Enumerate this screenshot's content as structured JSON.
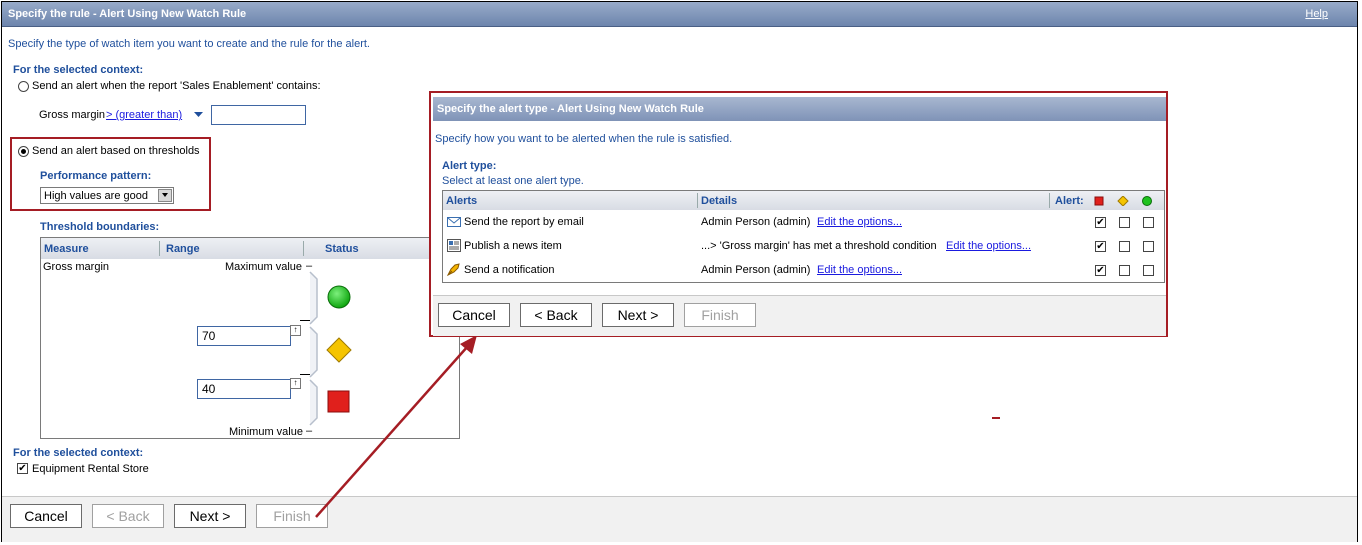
{
  "main_dialog": {
    "title": "Specify the rule - Alert Using New Watch Rule",
    "help": "Help",
    "instructions": "Specify the type of watch item you want to create and the rule for the alert.",
    "context_heading": "For the selected context:",
    "option_report": "Send an alert when the report 'Sales Enablement' contains:",
    "gross_margin_label": "Gross margin",
    "operator_link": "> (greater than)",
    "value_input": "",
    "option_thresholds": "Send an alert based on thresholds",
    "performance_heading": "Performance pattern:",
    "performance_value": "High values are good",
    "threshold_heading": "Threshold boundaries:",
    "threshold_table": {
      "columns": [
        "Measure",
        "Range",
        "Status"
      ],
      "measure": "Gross margin",
      "maximum_label": "Maximum value",
      "minimum_label": "Minimum value",
      "upper_value": "70",
      "lower_value": "40"
    },
    "context_heading_2": "For the selected context:",
    "store_label": "Equipment Rental Store",
    "buttons": {
      "cancel": "Cancel",
      "back": "< Back",
      "next": "Next >",
      "finish": "Finish"
    }
  },
  "alert_dialog": {
    "title": "Specify the alert type - Alert Using New Watch Rule",
    "instructions": "Specify how you want to be alerted when the rule is satisfied.",
    "alert_type_heading": "Alert type:",
    "alert_type_hint": "Select at least one alert type.",
    "columns": {
      "alerts": "Alerts",
      "details": "Details",
      "alert": "Alert:"
    },
    "rows": [
      {
        "name": "Send the report by email",
        "details": "Admin Person (admin)",
        "link": "Edit the options...",
        "icon": "email-icon",
        "checks": [
          true,
          false,
          false
        ]
      },
      {
        "name": "Publish a news item",
        "details": "...> 'Gross margin'  has met a threshold condition",
        "link": "Edit the options...",
        "icon": "news-icon",
        "checks": [
          true,
          false,
          false
        ]
      },
      {
        "name": "Send a notification",
        "details": "Admin Person (admin)",
        "link": "Edit the options...",
        "icon": "notification-icon",
        "checks": [
          true,
          false,
          false
        ]
      }
    ],
    "buttons": {
      "cancel": "Cancel",
      "back": "< Back",
      "next": "Next >",
      "finish": "Finish"
    }
  },
  "colors": {
    "red": "#e0201c",
    "yellow": "#f5c400",
    "green": "#1fc21f",
    "highlight": "#a51d24",
    "title_blue": "#1f4f9c"
  }
}
